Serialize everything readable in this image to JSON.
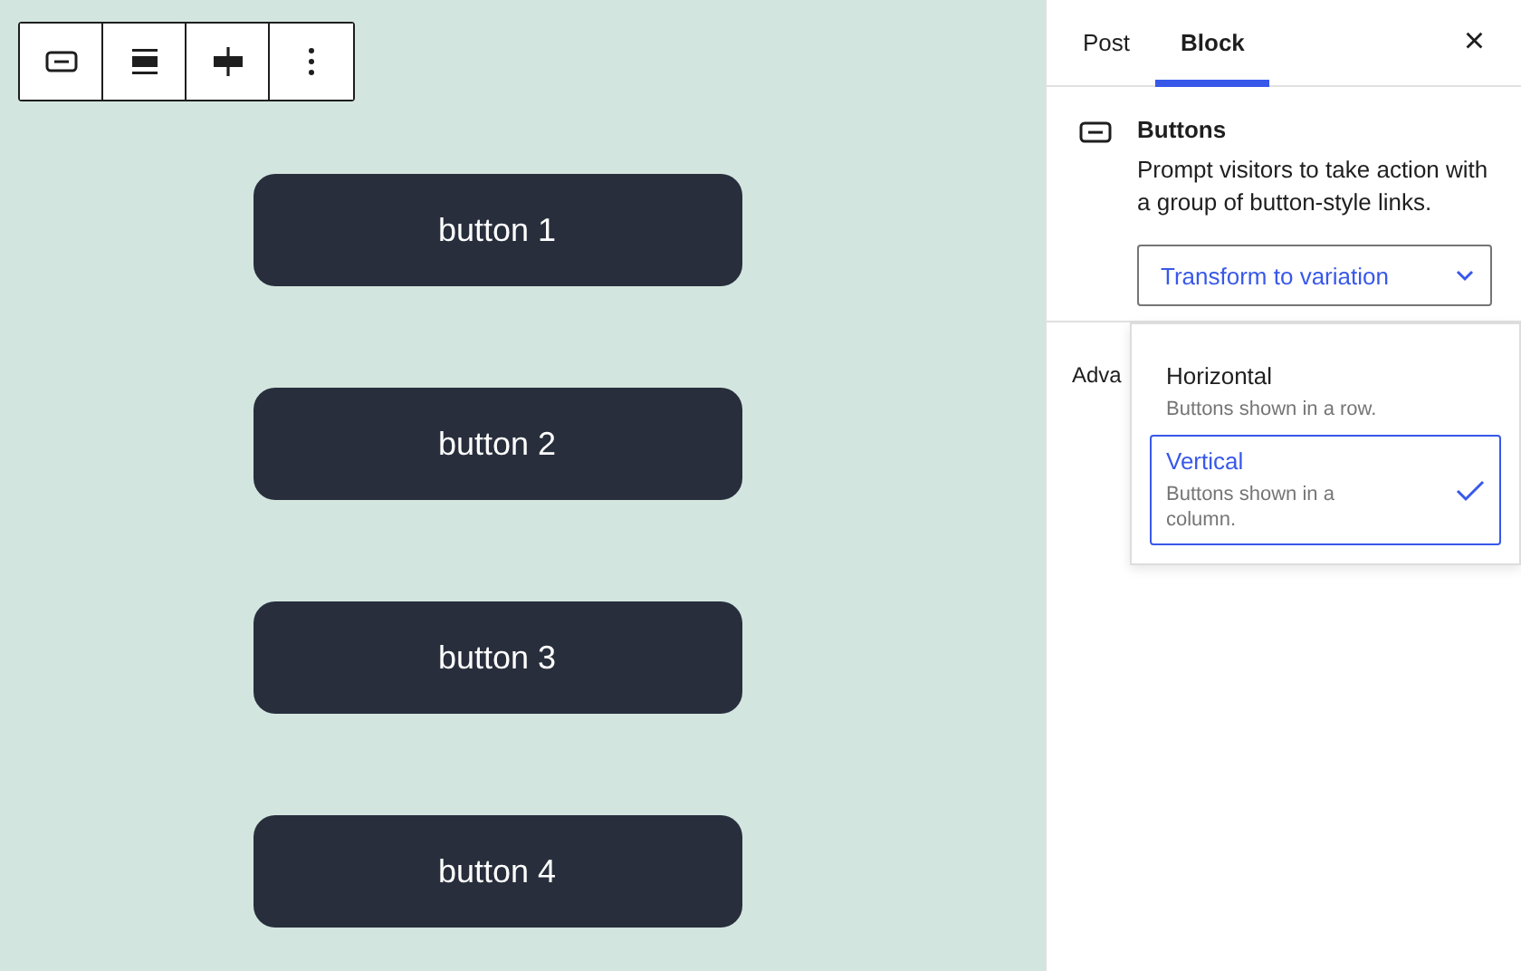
{
  "toolbar": [
    {
      "kind": "block"
    },
    {
      "kind": "align"
    },
    {
      "kind": "justify"
    },
    {
      "kind": "more"
    }
  ],
  "canvas": {
    "buttons": [
      "button 1",
      "button 2",
      "button 3",
      "button 4"
    ]
  },
  "sidebar": {
    "tabs": [
      {
        "label": "Post",
        "selected": false
      },
      {
        "label": "Block",
        "selected": true
      }
    ],
    "close": "×",
    "block": {
      "title": "Buttons",
      "description": "Prompt visitors to take action with a group of button-style links."
    },
    "transform": {
      "label": "Transform to variation"
    },
    "advanced_label": "Adva",
    "variations": [
      {
        "title": "Horizontal",
        "description": "Buttons shown in a row.",
        "selected": false
      },
      {
        "title": "Vertical",
        "description": "Buttons shown in a column.",
        "selected": true
      }
    ]
  }
}
